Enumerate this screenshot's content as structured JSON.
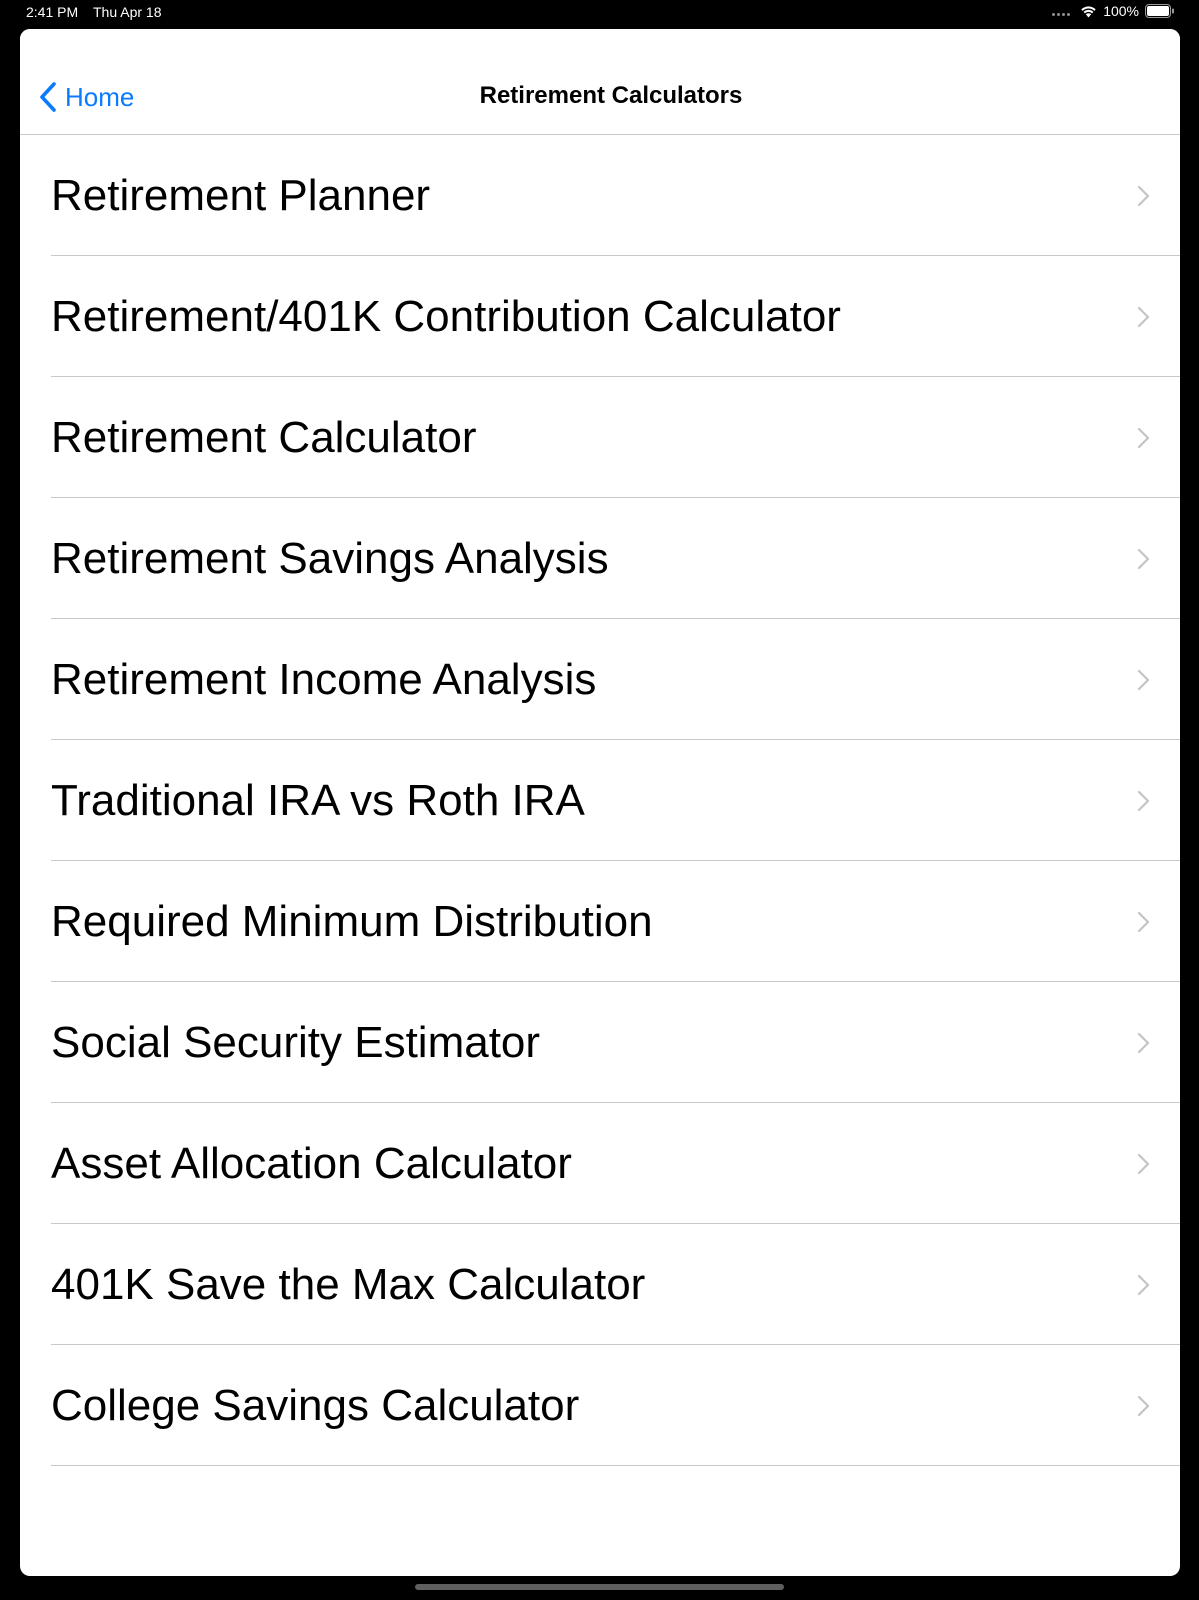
{
  "status_bar": {
    "time": "2:41 PM",
    "date": "Thu Apr 18",
    "battery_percent": "100%",
    "battery_level": 1.0
  },
  "nav": {
    "back_label": "Home",
    "title": "Retirement Calculators"
  },
  "items": [
    {
      "label": "Retirement Planner"
    },
    {
      "label": "Retirement/401K Contribution Calculator"
    },
    {
      "label": "Retirement Calculator"
    },
    {
      "label": "Retirement Savings Analysis"
    },
    {
      "label": "Retirement Income Analysis"
    },
    {
      "label": "Traditional IRA vs Roth IRA"
    },
    {
      "label": "Required Minimum Distribution"
    },
    {
      "label": "Social Security Estimator"
    },
    {
      "label": "Asset Allocation Calculator"
    },
    {
      "label": "401K Save the Max Calculator"
    },
    {
      "label": "College Savings Calculator"
    }
  ],
  "colors": {
    "accent": "#0a7aff",
    "separator": "#c8c7cc",
    "chevron": "#c4c4c7"
  },
  "icons": {
    "back": "chevron-left-icon",
    "row_disclosure": "chevron-right-icon",
    "wifi": "wifi-icon",
    "battery": "battery-icon",
    "cellular": "cellular-dots-icon"
  }
}
